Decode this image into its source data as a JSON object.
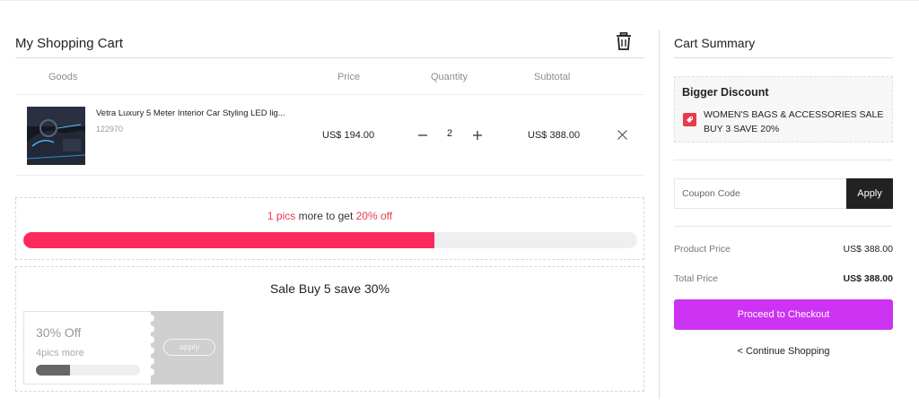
{
  "cart": {
    "title": "My Shopping Cart",
    "headers": {
      "goods": "Goods",
      "price": "Price",
      "quantity": "Quantity",
      "subtotal": "Subtotal"
    },
    "item": {
      "name": "Vetra Luxury 5 Meter Interior Car Styling LED lig...",
      "sku": "122970",
      "price": "US$ 194.00",
      "quantity": "2",
      "subtotal": "US$ 388.00"
    }
  },
  "promo": {
    "count": "1 pics",
    "middle": " more to get ",
    "discount": "20% off",
    "progress_percent": 67
  },
  "sale": {
    "title": "Sale Buy 5 save 30%",
    "coupon": {
      "off": "30% Off",
      "more": "4pics more",
      "progress_percent": 33,
      "button": "apply"
    }
  },
  "summary": {
    "title": "Cart Summary",
    "discount": {
      "title": "Bigger Discount",
      "line1": "WOMEN'S BAGS & ACCESSORIES SALE",
      "line2": "BUY 3 SAVE 20%"
    },
    "coupon_placeholder": "Coupon Code",
    "apply_label": "Apply",
    "product_price_label": "Product Price",
    "product_price_value": "US$ 388.00",
    "total_price_label": "Total Price",
    "total_price_value": "US$ 388.00",
    "checkout_label": "Proceed to Checkout",
    "continue_label": "< Continue Shopping"
  },
  "colors": {
    "accent_checkout": "#cc33f2",
    "progress_fill": "#fa2a5a",
    "promo_red": "#e83a4f",
    "apply_button": "#222222"
  },
  "icons": [
    "trash-icon",
    "minus-icon",
    "plus-icon",
    "close-icon",
    "tag-icon"
  ]
}
